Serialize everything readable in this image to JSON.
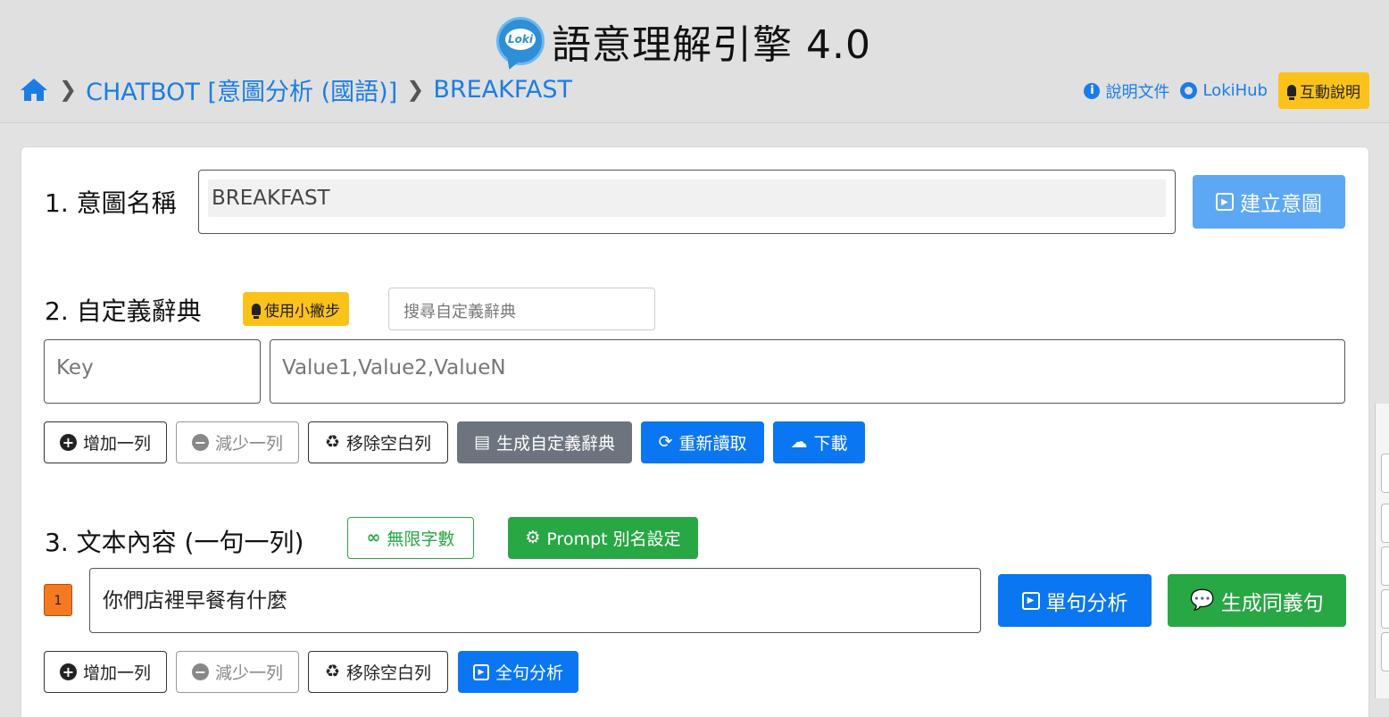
{
  "header": {
    "app_title": "語意理解引擎 4.0",
    "logo_text": "Loki",
    "breadcrumb": [
      "CHATBOT [意圖分析 (國語)]",
      "BREAKFAST"
    ],
    "links": {
      "docs": "說明文件",
      "lokihub": "LokiHub",
      "help": "互動說明"
    }
  },
  "intent": {
    "label": "1. 意圖名稱",
    "value": "BREAKFAST",
    "create_button": "建立意圖"
  },
  "dictionary": {
    "label": "2. 自定義辭典",
    "tips_button": "使用小撇步",
    "search_placeholder": "搜尋自定義辭典",
    "key_placeholder": "Key",
    "value_placeholder": "Value1,Value2,ValueN",
    "buttons": {
      "add_row": "增加一列",
      "remove_row": "減少一列",
      "remove_empty": "移除空白列",
      "generate": "生成自定義辭典",
      "reload": "重新讀取",
      "download": "下載"
    }
  },
  "text": {
    "label": "3. 文本內容 (一句一列)",
    "unlimited_button": "無限字數",
    "prompt_button": "Prompt 別名設定",
    "rows": [
      {
        "num": "1",
        "value": "你們店裡早餐有什麼"
      }
    ],
    "analyze_button": "單句分析",
    "synonym_button": "生成同義句",
    "buttons": {
      "add_row": "增加一列",
      "remove_row": "減少一列",
      "remove_empty": "移除空白列",
      "analyze_all": "全句分析"
    }
  },
  "colors": {
    "primary": "#0a76f2",
    "success": "#28a745",
    "warning": "#fbc21a",
    "secondary": "#6c757d",
    "badge": "#f47920"
  }
}
